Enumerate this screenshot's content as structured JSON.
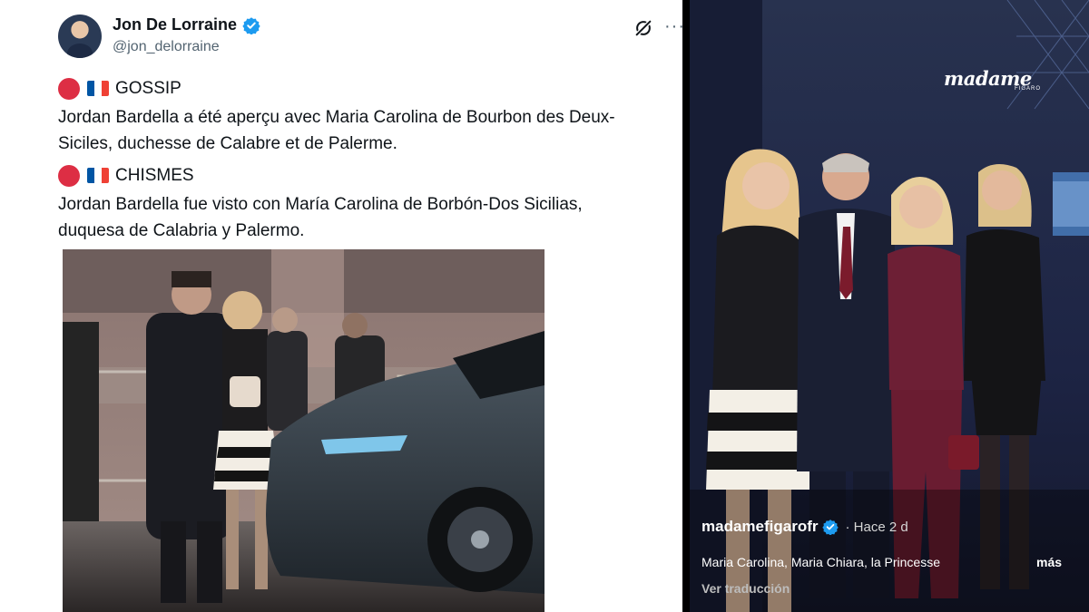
{
  "tweet": {
    "author_name": "Jon De Lorraine",
    "author_handle": "@jon_delorraine",
    "tag1": "GOSSIP",
    "text1_line1": "Jordan Bardella a été aperçu avec Maria Carolina de Bourbon des Deux-",
    "text1_line2": "Siciles, duchesse de Calabre et de Palerme.",
    "tag2": "CHISMES",
    "text2_line1": "Jordan Bardella fue visto con María Carolina de Borbón-Dos Sicilias,",
    "text2_line2": "duquesa de Calabria y Palermo.",
    "more_glyph": "···"
  },
  "instagram": {
    "brand": "madame",
    "brand_sub": "FIGARO",
    "username": "madamefigarofr",
    "time": "· Hace 2 d",
    "caption": "Maria Carolina, Maria Chiara, la Princesse",
    "more_label": "más",
    "translate_label": "Ver traducción"
  },
  "colors": {
    "verified_blue": "#1d9bf0",
    "dot_red": "#dd2e44",
    "flag_blue": "#0055a4",
    "flag_red": "#ef4135",
    "insta_bg": "#1b2446"
  },
  "icons": [
    "verified-badge-icon",
    "grok-icon",
    "more-options-icon",
    "red-circle-emoji",
    "france-flag-emoji"
  ]
}
